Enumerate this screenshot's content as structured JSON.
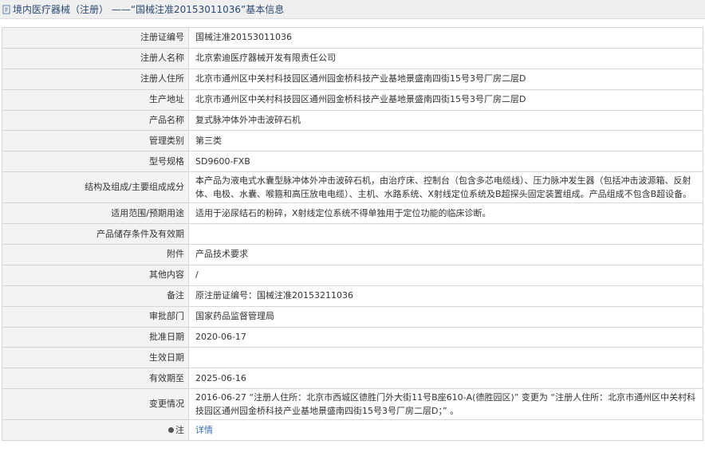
{
  "header": {
    "title": "境内医疗器械（注册） ——“国械注准20153011036”基本信息"
  },
  "rows": [
    {
      "label": "注册证编号",
      "value": "国械注准20153011036"
    },
    {
      "label": "注册人名称",
      "value": "北京索迪医疗器械开发有限责任公司"
    },
    {
      "label": "注册人住所",
      "value": "北京市通州区中关村科技园区通州园金桥科技产业基地景盛南四街15号3号厂房二层D"
    },
    {
      "label": "生产地址",
      "value": "北京市通州区中关村科技园区通州园金桥科技产业基地景盛南四街15号3号厂房二层D"
    },
    {
      "label": "产品名称",
      "value": "复式脉冲体外冲击波碎石机"
    },
    {
      "label": "管理类别",
      "value": "第三类"
    },
    {
      "label": "型号规格",
      "value": "SD9600-FXB"
    },
    {
      "label": "结构及组成/主要组成成分",
      "value": "本产品为液电式水囊型脉冲体外冲击波碎石机，由治疗床、控制台（包含多芯电缆线）、压力脉冲发生器（包括冲击波源箱、反射体、电极、水囊、喉箍和高压放电电缆）、主机、水路系统、X射线定位系统及B超探头固定装置组成。产品组成不包含B超设备。"
    },
    {
      "label": "适用范围/预期用途",
      "value": "适用于泌尿结石的粉碎，X射线定位系统不得单独用于定位功能的临床诊断。"
    },
    {
      "label": "产品储存条件及有效期",
      "value": ""
    },
    {
      "label": "附件",
      "value": "产品技术要求"
    },
    {
      "label": "其他内容",
      "value": "/"
    },
    {
      "label": "备注",
      "value": "原注册证编号：国械注准20153211036"
    },
    {
      "label": "审批部门",
      "value": "国家药品监督管理局"
    },
    {
      "label": "批准日期",
      "value": "2020-06-17"
    },
    {
      "label": "生效日期",
      "value": ""
    },
    {
      "label": "有效期至",
      "value": "2025-06-16"
    },
    {
      "label": "变更情况",
      "value": "2016-06-27 “注册人住所：北京市西城区德胜门外大街11号B座610-A(德胜园区)” 变更为 “注册人住所：北京市通州区中关村科技园区通州园金桥科技产业基地景盛南四街15号3号厂房二层D；” 。"
    },
    {
      "label": "注",
      "value": "详情"
    }
  ]
}
